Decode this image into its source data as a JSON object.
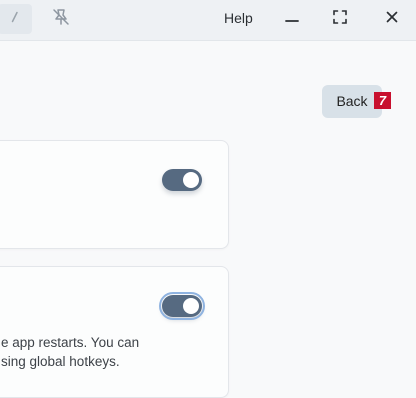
{
  "titlebar": {
    "edit_icon": "pencil-icon",
    "pin_icon": "pin-off-icon",
    "help_label": "Help",
    "minimize_icon": "minimize-icon",
    "maximize_icon": "maximize-icon",
    "close_icon": "close-icon"
  },
  "main": {
    "back_label": "Back",
    "back_badge": "7",
    "settings": [
      {
        "toggle_on": true,
        "description_lines": []
      },
      {
        "toggle_on": true,
        "description_lines": [
          "e app restarts. You can",
          "sing global hotkeys."
        ]
      }
    ]
  },
  "colors": {
    "toggle_on": "#566a81",
    "badge": "#c8102e",
    "back_button": "#d8e1e8",
    "focus_ring": "#8fb3e0"
  }
}
